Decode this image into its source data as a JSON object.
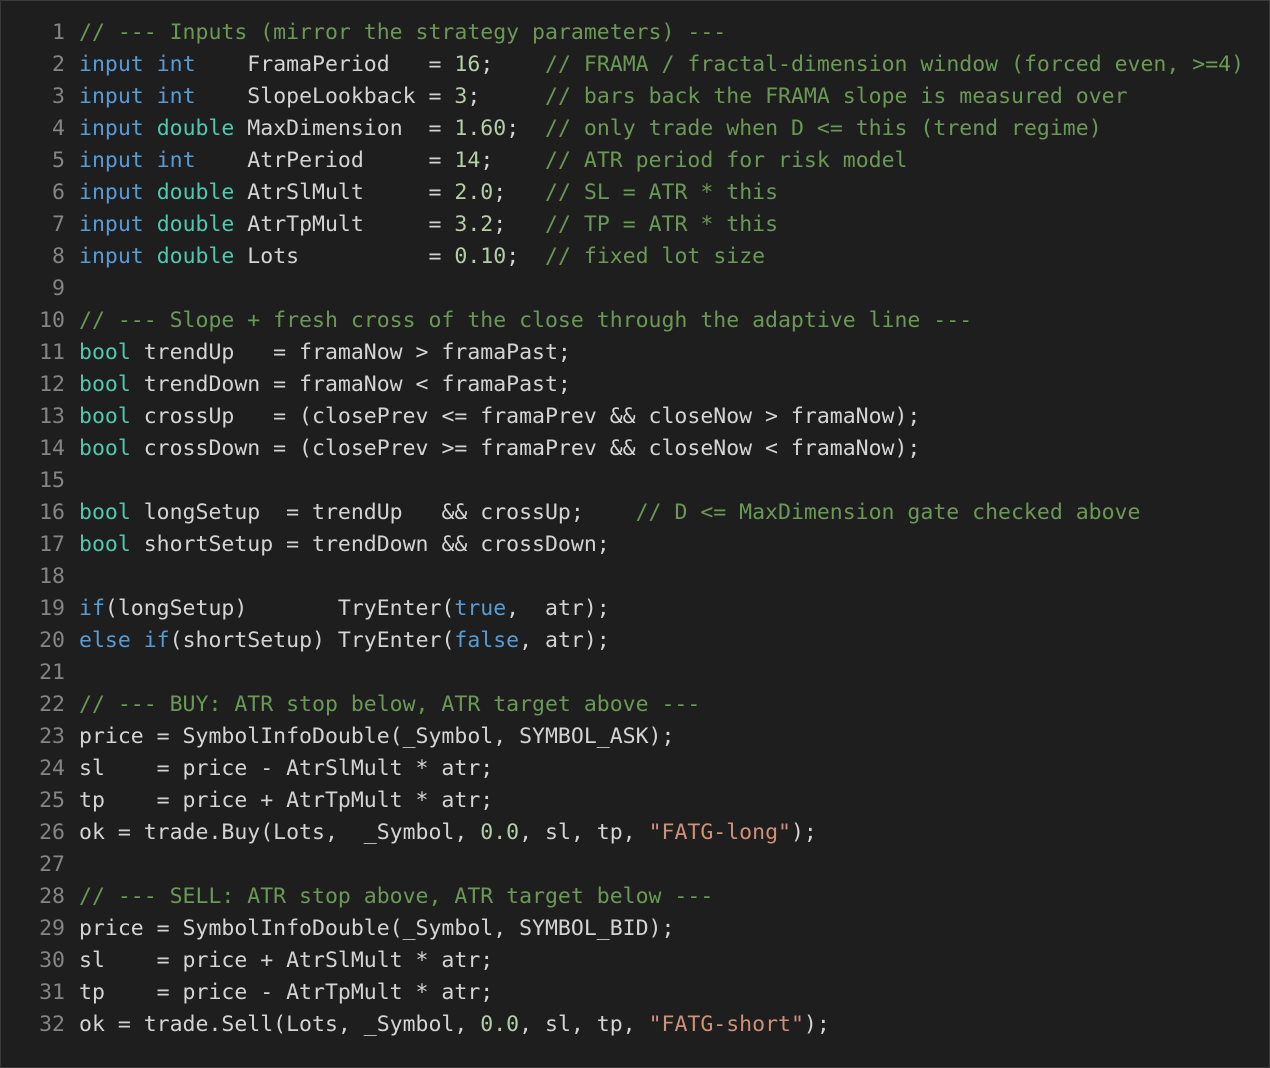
{
  "colors": {
    "background": "#1e1e1e",
    "border": "#3a3a3a",
    "line_number": "#858585",
    "plain": "#d4d4d4",
    "comment": "#6a9955",
    "keyword": "#569cd6",
    "type": "#4ec9b0",
    "number": "#b5cea8",
    "string": "#ce9178"
  },
  "editor": {
    "lines": [
      {
        "n": "1",
        "tokens": [
          [
            "comment",
            "// --- Inputs (mirror the strategy parameters) ---"
          ]
        ]
      },
      {
        "n": "2",
        "tokens": [
          [
            "kw",
            "input"
          ],
          [
            "plain",
            " "
          ],
          [
            "kw",
            "int"
          ],
          [
            "plain",
            "    FramaPeriod   = "
          ],
          [
            "num",
            "16"
          ],
          [
            "plain",
            ";    "
          ],
          [
            "comment",
            "// FRAMA / fractal-dimension window (forced even, >=4)"
          ]
        ]
      },
      {
        "n": "3",
        "tokens": [
          [
            "kw",
            "input"
          ],
          [
            "plain",
            " "
          ],
          [
            "kw",
            "int"
          ],
          [
            "plain",
            "    SlopeLookback = "
          ],
          [
            "num",
            "3"
          ],
          [
            "plain",
            ";     "
          ],
          [
            "comment",
            "// bars back the FRAMA slope is measured over"
          ]
        ]
      },
      {
        "n": "4",
        "tokens": [
          [
            "kw",
            "input"
          ],
          [
            "plain",
            " "
          ],
          [
            "type",
            "double"
          ],
          [
            "plain",
            " MaxDimension  = "
          ],
          [
            "num",
            "1.60"
          ],
          [
            "plain",
            ";  "
          ],
          [
            "comment",
            "// only trade when D <= this (trend regime)"
          ]
        ]
      },
      {
        "n": "5",
        "tokens": [
          [
            "kw",
            "input"
          ],
          [
            "plain",
            " "
          ],
          [
            "kw",
            "int"
          ],
          [
            "plain",
            "    AtrPeriod     = "
          ],
          [
            "num",
            "14"
          ],
          [
            "plain",
            ";    "
          ],
          [
            "comment",
            "// ATR period for risk model"
          ]
        ]
      },
      {
        "n": "6",
        "tokens": [
          [
            "kw",
            "input"
          ],
          [
            "plain",
            " "
          ],
          [
            "type",
            "double"
          ],
          [
            "plain",
            " AtrSlMult     = "
          ],
          [
            "num",
            "2.0"
          ],
          [
            "plain",
            ";   "
          ],
          [
            "comment",
            "// SL = ATR * this"
          ]
        ]
      },
      {
        "n": "7",
        "tokens": [
          [
            "kw",
            "input"
          ],
          [
            "plain",
            " "
          ],
          [
            "type",
            "double"
          ],
          [
            "plain",
            " AtrTpMult     = "
          ],
          [
            "num",
            "3.2"
          ],
          [
            "plain",
            ";   "
          ],
          [
            "comment",
            "// TP = ATR * this"
          ]
        ]
      },
      {
        "n": "8",
        "tokens": [
          [
            "kw",
            "input"
          ],
          [
            "plain",
            " "
          ],
          [
            "type",
            "double"
          ],
          [
            "plain",
            " Lots          = "
          ],
          [
            "num",
            "0.10"
          ],
          [
            "plain",
            ";  "
          ],
          [
            "comment",
            "// fixed lot size"
          ]
        ]
      },
      {
        "n": "9",
        "tokens": []
      },
      {
        "n": "10",
        "tokens": [
          [
            "comment",
            "// --- Slope + fresh cross of the close through the adaptive line ---"
          ]
        ]
      },
      {
        "n": "11",
        "tokens": [
          [
            "type",
            "bool"
          ],
          [
            "plain",
            " trendUp   = framaNow > framaPast;"
          ]
        ]
      },
      {
        "n": "12",
        "tokens": [
          [
            "type",
            "bool"
          ],
          [
            "plain",
            " trendDown = framaNow < framaPast;"
          ]
        ]
      },
      {
        "n": "13",
        "tokens": [
          [
            "type",
            "bool"
          ],
          [
            "plain",
            " crossUp   = (closePrev <= framaPrev && closeNow > framaNow);"
          ]
        ]
      },
      {
        "n": "14",
        "tokens": [
          [
            "type",
            "bool"
          ],
          [
            "plain",
            " crossDown = (closePrev >= framaPrev && closeNow < framaNow);"
          ]
        ]
      },
      {
        "n": "15",
        "tokens": []
      },
      {
        "n": "16",
        "tokens": [
          [
            "type",
            "bool"
          ],
          [
            "plain",
            " longSetup  = trendUp   && crossUp;    "
          ],
          [
            "comment",
            "// D <= MaxDimension gate checked above"
          ]
        ]
      },
      {
        "n": "17",
        "tokens": [
          [
            "type",
            "bool"
          ],
          [
            "plain",
            " shortSetup = trendDown && crossDown;"
          ]
        ]
      },
      {
        "n": "18",
        "tokens": []
      },
      {
        "n": "19",
        "tokens": [
          [
            "kw",
            "if"
          ],
          [
            "plain",
            "(longSetup)       TryEnter("
          ],
          [
            "kw",
            "true"
          ],
          [
            "plain",
            ",  atr);"
          ]
        ]
      },
      {
        "n": "20",
        "tokens": [
          [
            "kw",
            "else"
          ],
          [
            "plain",
            " "
          ],
          [
            "kw",
            "if"
          ],
          [
            "plain",
            "(shortSetup) TryEnter("
          ],
          [
            "kw",
            "false"
          ],
          [
            "plain",
            ", atr);"
          ]
        ]
      },
      {
        "n": "21",
        "tokens": []
      },
      {
        "n": "22",
        "tokens": [
          [
            "comment",
            "// --- BUY: ATR stop below, ATR target above ---"
          ]
        ]
      },
      {
        "n": "23",
        "tokens": [
          [
            "plain",
            "price = SymbolInfoDouble(_Symbol, SYMBOL_ASK);"
          ]
        ]
      },
      {
        "n": "24",
        "tokens": [
          [
            "plain",
            "sl    = price - AtrSlMult * atr;"
          ]
        ]
      },
      {
        "n": "25",
        "tokens": [
          [
            "plain",
            "tp    = price + AtrTpMult * atr;"
          ]
        ]
      },
      {
        "n": "26",
        "tokens": [
          [
            "plain",
            "ok = trade.Buy(Lots,  _Symbol, "
          ],
          [
            "num",
            "0.0"
          ],
          [
            "plain",
            ", sl, tp, "
          ],
          [
            "str",
            "\"FATG-long\""
          ],
          [
            "plain",
            ");"
          ]
        ]
      },
      {
        "n": "27",
        "tokens": []
      },
      {
        "n": "28",
        "tokens": [
          [
            "comment",
            "// --- SELL: ATR stop above, ATR target below ---"
          ]
        ]
      },
      {
        "n": "29",
        "tokens": [
          [
            "plain",
            "price = SymbolInfoDouble(_Symbol, SYMBOL_BID);"
          ]
        ]
      },
      {
        "n": "30",
        "tokens": [
          [
            "plain",
            "sl    = price + AtrSlMult * atr;"
          ]
        ]
      },
      {
        "n": "31",
        "tokens": [
          [
            "plain",
            "tp    = price - AtrTpMult * atr;"
          ]
        ]
      },
      {
        "n": "32",
        "tokens": [
          [
            "plain",
            "ok = trade.Sell(Lots, _Symbol, "
          ],
          [
            "num",
            "0.0"
          ],
          [
            "plain",
            ", sl, tp, "
          ],
          [
            "str",
            "\"FATG-short\""
          ],
          [
            "plain",
            ");"
          ]
        ]
      }
    ]
  }
}
